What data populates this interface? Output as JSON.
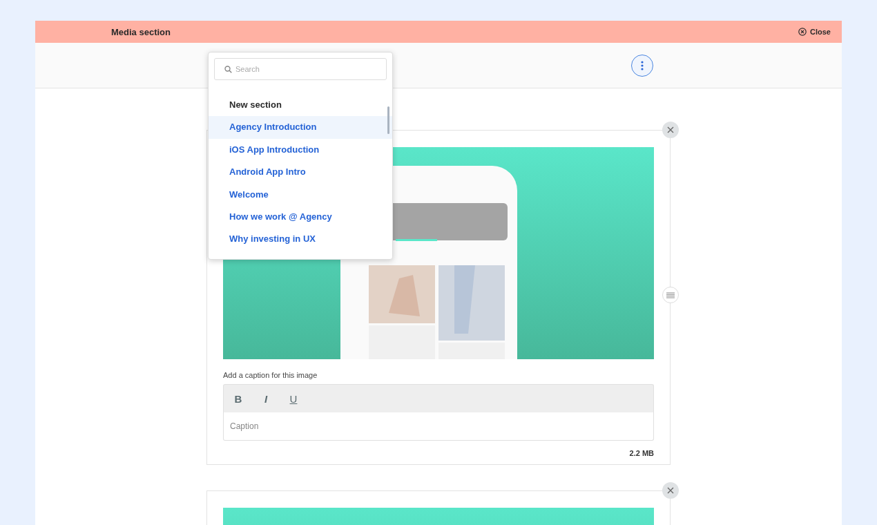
{
  "header": {
    "title": "Media section",
    "close_label": "Close"
  },
  "dropdown": {
    "search_placeholder": "Search",
    "items": [
      {
        "label": "New section",
        "kind": "heading",
        "selected": false
      },
      {
        "label": "Agency Introduction",
        "kind": "link",
        "selected": true
      },
      {
        "label": "iOS App Introduction",
        "kind": "link",
        "selected": false
      },
      {
        "label": "Android App Intro",
        "kind": "link",
        "selected": false
      },
      {
        "label": "Welcome",
        "kind": "link",
        "selected": false
      },
      {
        "label": "How we work @ Agency",
        "kind": "link",
        "selected": false
      },
      {
        "label": "Why investing in UX",
        "kind": "link",
        "selected": false
      }
    ]
  },
  "media_items": [
    {
      "kind": "picture",
      "caption_label": "Add a caption for this image",
      "format_buttons": [
        {
          "label": "B",
          "kind": "bold"
        },
        {
          "label": "I",
          "kind": "italic"
        },
        {
          "label": "U",
          "kind": "underline"
        }
      ],
      "caption_placeholder": "Caption",
      "file_size": "2.2 MB"
    },
    {
      "kind": "picture"
    }
  ]
}
